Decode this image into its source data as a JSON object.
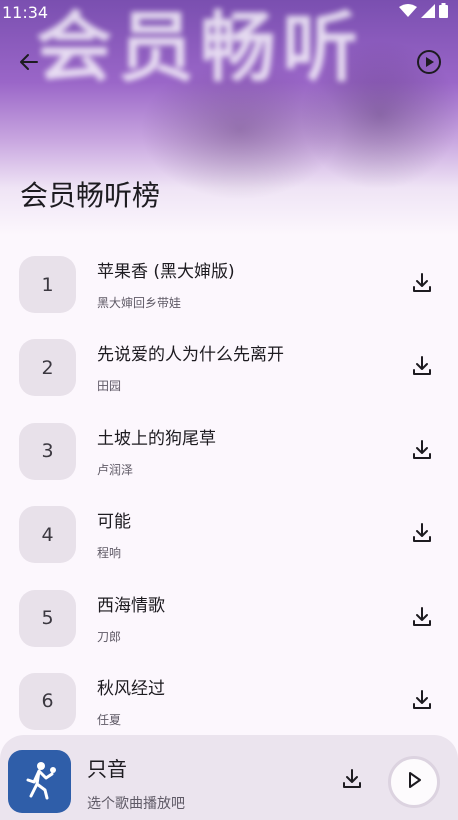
{
  "status_bar": {
    "time": "11:34",
    "icons": [
      "wifi-icon",
      "signal-icon",
      "battery-icon"
    ]
  },
  "header": {
    "banner_text": "会员畅听",
    "title": "会员畅听榜",
    "back_icon": "arrow-left-icon",
    "play_icon": "play-circle-icon"
  },
  "songs": [
    {
      "rank": "1",
      "title": "苹果香 (黑大婶版)",
      "artist": "黑大婶回乡带娃"
    },
    {
      "rank": "2",
      "title": "先说爱的人为什么先离开",
      "artist": "田园"
    },
    {
      "rank": "3",
      "title": "土坡上的狗尾草",
      "artist": "卢润泽"
    },
    {
      "rank": "4",
      "title": "可能",
      "artist": "程响"
    },
    {
      "rank": "5",
      "title": "西海情歌",
      "artist": "刀郎"
    },
    {
      "rank": "6",
      "title": "秋风经过",
      "artist": "任夏"
    }
  ],
  "player": {
    "title": "只音",
    "subtitle": "选个歌曲播放吧",
    "art_icon": "basketball-player-icon",
    "download_icon": "download-icon",
    "play_icon": "play-icon"
  },
  "colors": {
    "header_purple": "#7a4fb0",
    "background": "#fcf7fd",
    "rank_box": "#e8e1ea",
    "player_bg": "#ebe4ee",
    "album_art": "#2f5ea9"
  }
}
